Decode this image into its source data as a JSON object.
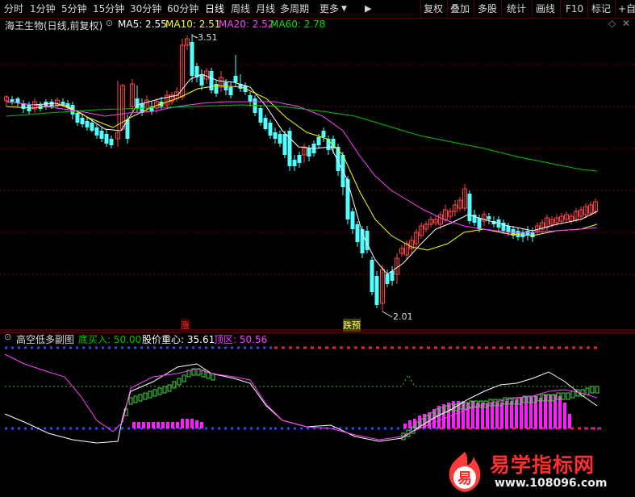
{
  "toolbar": {
    "tabs": [
      "分时",
      "1分钟",
      "5分钟",
      "15分钟",
      "30分钟",
      "60分钟",
      "日线",
      "周线",
      "月线",
      "多周期",
      "更多"
    ],
    "active_tab": "日线",
    "right_buttons": [
      "复权",
      "叠加",
      "多股",
      "统计",
      "画线",
      "F10",
      "标记",
      "+自选"
    ]
  },
  "main": {
    "stock_title": "海王生物(日线,前复权)",
    "ma5": "MA5: 2.55",
    "ma10": "MA10: 2.51",
    "ma20": "MA20: 2.52",
    "ma60": "MA60: 2.78",
    "high_label": "3.51",
    "low_label": "2.01",
    "marker_zhang": "涨",
    "marker_dieyu": "跌预",
    "colors": {
      "up": "#ff4040",
      "down": "#54ffff",
      "ma5": "#ffffff",
      "ma10": "#ffff00",
      "ma20": "#ff40ff",
      "ma60": "#00c000"
    }
  },
  "sub": {
    "indicator_name": "高空低多副图",
    "buy_label": "底买入: 50.00",
    "center_label": "股价重心: 35.61",
    "top_label": "顶区: 50.56"
  },
  "watermark": {
    "text": "易学指标网",
    "url": "www.108096.com",
    "glyph": "易"
  }
}
